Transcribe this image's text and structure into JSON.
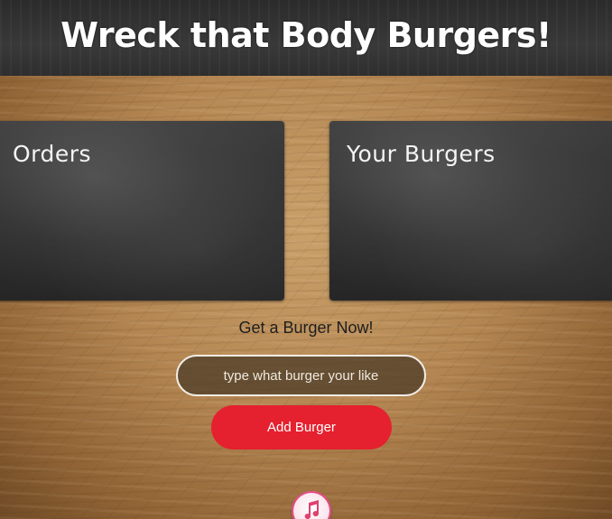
{
  "header": {
    "title": "Wreck that Body Burgers!"
  },
  "boards": {
    "orders_title": "Orders",
    "yours_title": "Your Burgers"
  },
  "form": {
    "prompt": "Get a Burger Now!",
    "input_placeholder": "type what burger your like",
    "input_value": "",
    "submit_label": "Add Burger"
  },
  "colors": {
    "accent_button": "#e5202f",
    "header_bg": "#333333",
    "board_bg": "#303030"
  },
  "icons": {
    "dock_icon": "music-note-icon"
  }
}
